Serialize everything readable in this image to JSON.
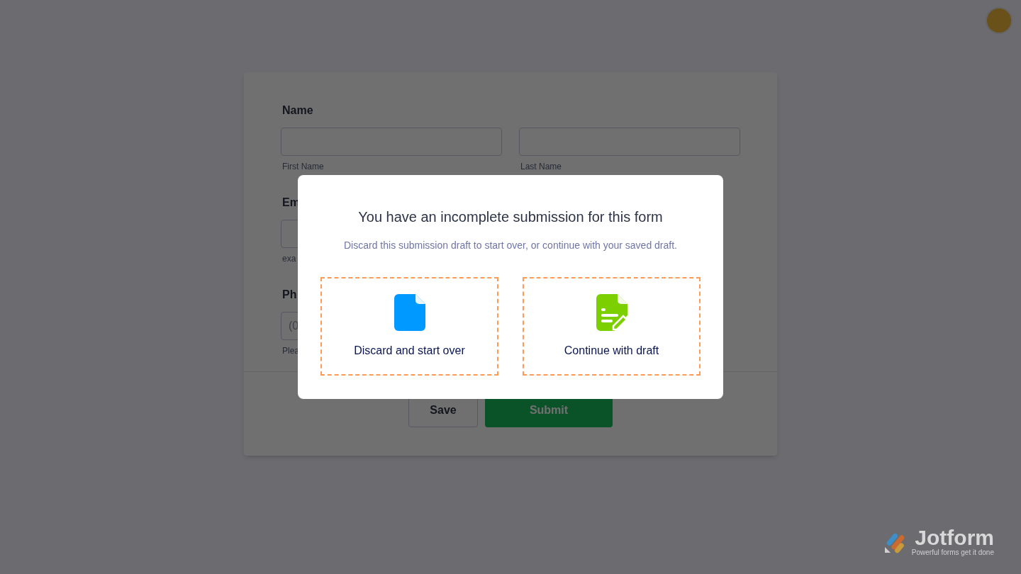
{
  "form": {
    "fields": [
      {
        "label": "Name",
        "inputs": [
          {
            "sublabel": "First Name"
          },
          {
            "sublabel": "Last Name"
          }
        ]
      },
      {
        "label": "Em",
        "inputs": [
          {
            "sublabel": "exa"
          }
        ]
      },
      {
        "label": "Ph",
        "inputs": [
          {
            "sublabel": "Plea",
            "placeholder": "(0"
          }
        ]
      }
    ],
    "buttons": [
      {
        "label": "Save",
        "kind": "secondary"
      },
      {
        "label": "Submit",
        "kind": "primary"
      }
    ]
  },
  "dialog": {
    "title": "You have an incomplete submission for this form",
    "message": "Discard this submission draft to start over, or continue with your saved draft.",
    "options": [
      {
        "label": "Discard and start over",
        "kind": "discard"
      },
      {
        "label": "Continue with draft",
        "kind": "continue"
      }
    ]
  },
  "branding": {
    "name": "Jotform",
    "tagline": "Powerful forms get it done"
  }
}
